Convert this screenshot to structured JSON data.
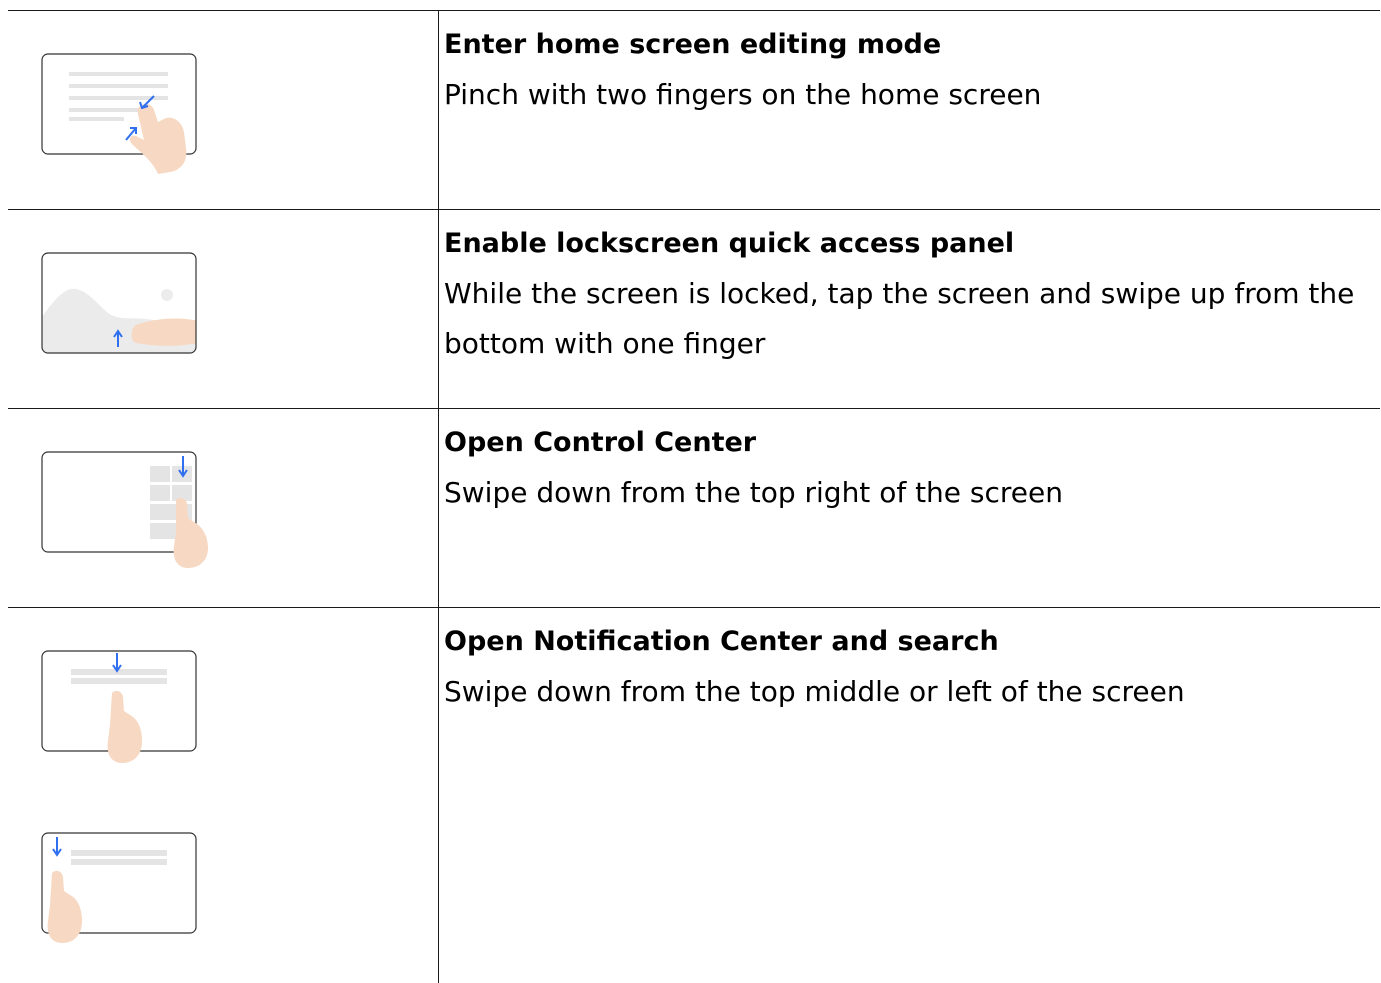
{
  "rows": [
    {
      "title": "Enter home screen editing mode",
      "description": "Pinch with two fingers on the home screen",
      "illustrations": [
        "pinch-gesture-icon"
      ]
    },
    {
      "title": "Enable lockscreen quick access panel",
      "description": "While the screen is locked, tap the screen and swipe up from the bottom with one finger",
      "illustrations": [
        "swipe-up-gesture-icon"
      ]
    },
    {
      "title": "Open Control Center",
      "description": "Swipe down from the top right of the screen",
      "illustrations": [
        "swipe-down-top-right-icon"
      ]
    },
    {
      "title": "Open Notification Center and search",
      "description": "Swipe down from the top middle or left of the screen",
      "illustrations": [
        "swipe-down-top-middle-icon",
        "swipe-down-top-left-icon"
      ]
    }
  ],
  "colors": {
    "border": "#1a1a1a",
    "accent_arrow": "#2f6ff0",
    "skin": "#f7d8c2",
    "ui_gray": "#e4e4e4"
  }
}
